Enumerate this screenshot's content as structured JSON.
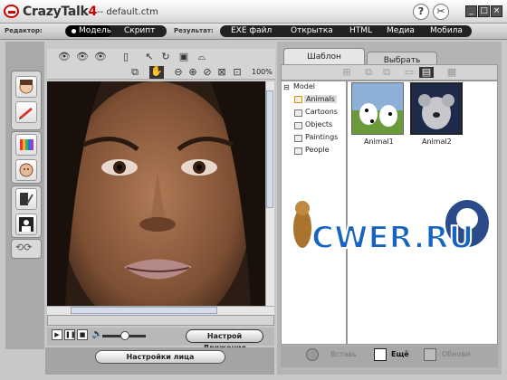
{
  "app": {
    "name_main": "CrazyTalk",
    "name_ver": "4",
    "doc": "-- default.ctm"
  },
  "titlebar": {
    "help": "?",
    "tools": "✂"
  },
  "menubar": {
    "editor_label": "Редактор:",
    "modes": [
      "Модель",
      "Скрипт"
    ],
    "result_label": "Результат:",
    "outputs": [
      "EXE файл",
      "Открытка",
      "HTML",
      "Медиа",
      "Мобила"
    ]
  },
  "viewer": {
    "zoom": "100%"
  },
  "playback": {
    "motion_button": "Настрой Движения",
    "face_button": "Настройки лица"
  },
  "library": {
    "tabs": [
      "Шаблон",
      "Выбрать"
    ],
    "tree_root": "Model",
    "categories": [
      "Animals",
      "Cartoons",
      "Objects",
      "Paintings",
      "People"
    ],
    "selected_category": "Animals",
    "items": [
      {
        "label": "Animal1"
      },
      {
        "label": "Animal2"
      }
    ],
    "actions": [
      "Вставь",
      "Ещё",
      "Обнови"
    ]
  },
  "watermark": {
    "text": "CWER.RU"
  },
  "colors": {
    "accent": "#cc0000",
    "watermark_blue": "#1565c0"
  }
}
